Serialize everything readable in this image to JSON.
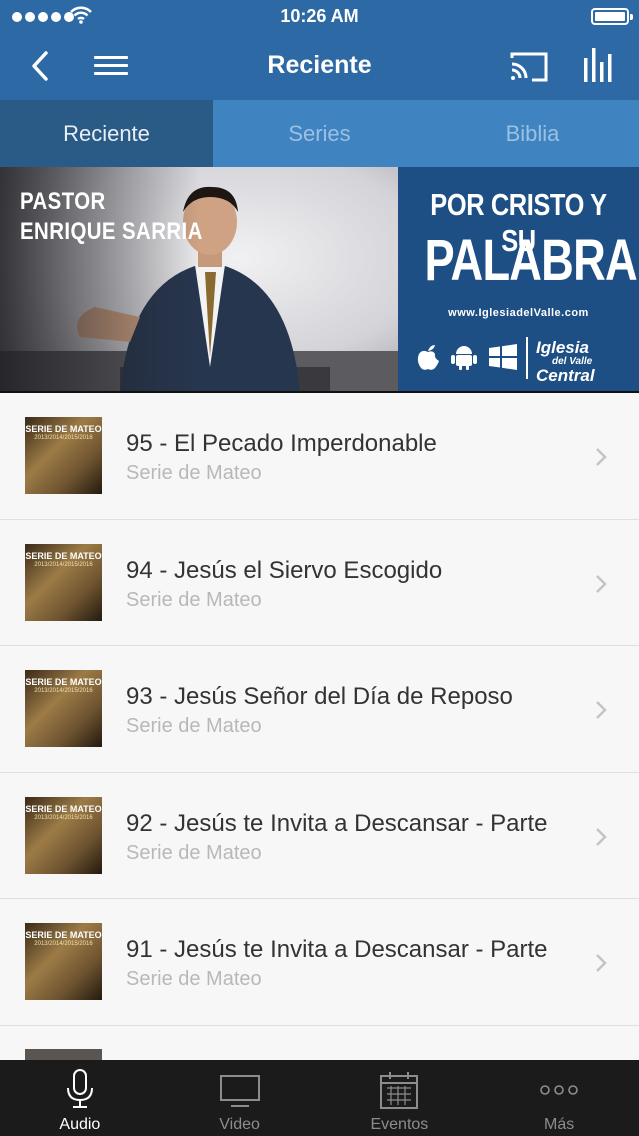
{
  "status": {
    "time": "10:26 AM"
  },
  "nav": {
    "title": "Reciente"
  },
  "tabs": [
    {
      "label": "Reciente",
      "active": true
    },
    {
      "label": "Series",
      "active": false
    },
    {
      "label": "Biblia",
      "active": false
    }
  ],
  "banner": {
    "pastor_line1": "PASTOR",
    "pastor_line2": "ENRIQUE SARRIA",
    "title_line1": "POR CRISTO Y SU",
    "title_line2": "PALABRA",
    "url": "www.IglesiadelValle.com",
    "logo_line1": "Iglesia",
    "logo_line2": "del Valle",
    "logo_line3": "Central"
  },
  "thumbnail": {
    "title": "SERIE DE MATEO",
    "years": "2013/2014/2015/2016"
  },
  "items": [
    {
      "title": "95 - El Pecado Imperdonable",
      "subtitle": "Serie de Mateo"
    },
    {
      "title": "94 - Jesús el Siervo Escogido",
      "subtitle": "Serie de Mateo"
    },
    {
      "title": "93 - Jesús Señor del Día de Reposo",
      "subtitle": "Serie de Mateo"
    },
    {
      "title": "92 - Jesús te Invita a Descansar - Parte",
      "subtitle": "Serie de Mateo"
    },
    {
      "title": "91 - Jesús te Invita a Descansar - Parte",
      "subtitle": "Serie de Mateo"
    }
  ],
  "tabbar": [
    {
      "label": "Audio",
      "icon": "microphone-icon",
      "active": true
    },
    {
      "label": "Video",
      "icon": "monitor-icon",
      "active": false
    },
    {
      "label": "Eventos",
      "icon": "calendar-icon",
      "active": false
    },
    {
      "label": "Más",
      "icon": "more-dots-icon",
      "active": false
    }
  ],
  "colors": {
    "header": "#2d6aa5",
    "tab_active": "#2a5b87",
    "tab_inactive": "#3f83c1",
    "tabbar": "#1b1b1b"
  }
}
